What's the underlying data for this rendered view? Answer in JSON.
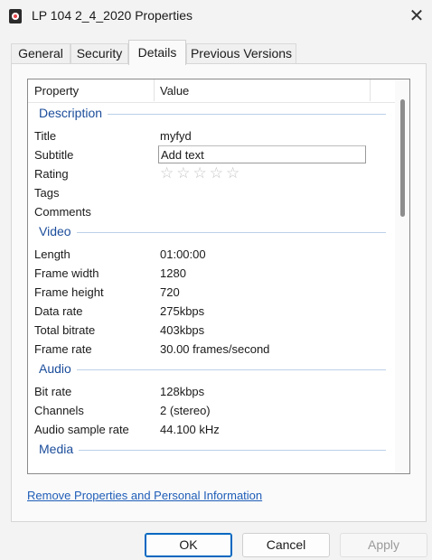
{
  "window": {
    "title": "LP 104 2_4_2020 Properties",
    "close_glyph": "✕"
  },
  "tabs": [
    {
      "label": "General"
    },
    {
      "label": "Security"
    },
    {
      "label": "Details"
    },
    {
      "label": "Previous Versions"
    }
  ],
  "active_tab": "Details",
  "list": {
    "col_property": "Property",
    "col_value": "Value",
    "sections": {
      "description": {
        "label": "Description",
        "title": {
          "prop": "Title",
          "val": "myfyd"
        },
        "subtitle": {
          "prop": "Subtitle",
          "val": "Add text"
        },
        "rating": {
          "prop": "Rating",
          "stars": "☆☆☆☆☆",
          "value": 0,
          "max": 5
        },
        "tags": {
          "prop": "Tags",
          "val": ""
        },
        "comments": {
          "prop": "Comments",
          "val": ""
        }
      },
      "video": {
        "label": "Video",
        "rows": [
          {
            "prop": "Length",
            "val": "01:00:00"
          },
          {
            "prop": "Frame width",
            "val": "1280"
          },
          {
            "prop": "Frame height",
            "val": "720"
          },
          {
            "prop": "Data rate",
            "val": "275kbps"
          },
          {
            "prop": "Total bitrate",
            "val": "403kbps"
          },
          {
            "prop": "Frame rate",
            "val": "30.00 frames/second"
          }
        ]
      },
      "audio": {
        "label": "Audio",
        "rows": [
          {
            "prop": "Bit rate",
            "val": "128kbps"
          },
          {
            "prop": "Channels",
            "val": "2 (stereo)"
          },
          {
            "prop": "Audio sample rate",
            "val": "44.100 kHz"
          }
        ]
      },
      "media": {
        "label": "Media"
      }
    }
  },
  "remove_link": "Remove Properties and Personal Information",
  "buttons": {
    "ok": "OK",
    "cancel": "Cancel",
    "apply": "Apply"
  },
  "colors": {
    "section_label": "#1b4d9b",
    "link": "#1f5db8",
    "accent": "#0067c0"
  }
}
